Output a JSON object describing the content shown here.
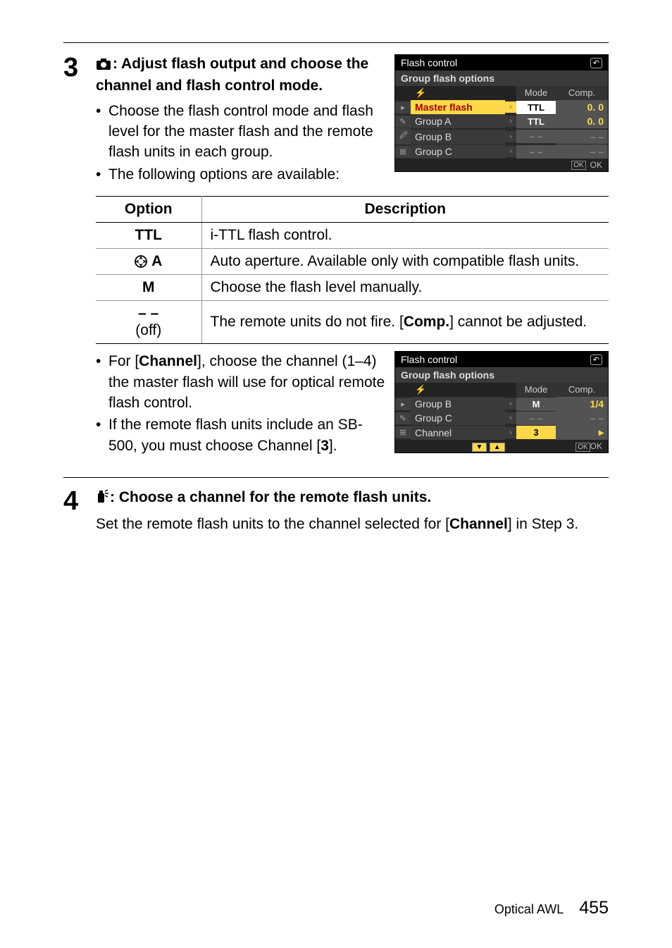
{
  "step3": {
    "number": "3",
    "heading_part1": ": Adjust flash output and choose the channel and flash control mode.",
    "bullet1": "Choose the flash control mode and flash level for the master flash and the remote flash units in each group.",
    "bullet2": "The following options are available:"
  },
  "menu1": {
    "title": "Flash control",
    "subtitle": "Group flash options",
    "col_mode": "Mode",
    "col_comp": "Comp.",
    "rows": [
      {
        "label": "Master flash",
        "mode": "TTL",
        "comp": "0. 0",
        "hl": true
      },
      {
        "label": "Group A",
        "mode": "TTL",
        "comp": "0. 0"
      },
      {
        "label": "Group B",
        "mode": "– –",
        "comp": "– –",
        "blank": true
      },
      {
        "label": "Group C",
        "mode": "– –",
        "comp": "– –",
        "blank": true
      }
    ],
    "ok": "OK"
  },
  "options_table": {
    "header_option": "Option",
    "header_desc": "Description",
    "rows": [
      {
        "opt": "TTL",
        "desc": "i-TTL flash control."
      },
      {
        "opt": "qA",
        "desc": "Auto aperture. Available only with compatible flash units.",
        "icon": true
      },
      {
        "opt": "M",
        "desc": "Choose the flash level manually."
      },
      {
        "opt_dash": "– –",
        "opt_sub": "(off)",
        "desc_pre": "The remote units do not fire. [",
        "desc_bold": "Comp.",
        "desc_post": "] cannot be adjusted."
      }
    ]
  },
  "step3b": {
    "bullet3_pre": "For [",
    "bullet3_bold": "Channel",
    "bullet3_post": "], choose the channel (1–4) the master flash will use for optical remote flash control.",
    "bullet4_pre": "If the remote flash units include an SB-500, you must choose Channel [",
    "bullet4_bold": "3",
    "bullet4_post": "]."
  },
  "menu2": {
    "title": "Flash control",
    "subtitle": "Group flash options",
    "col_mode": "Mode",
    "col_comp": "Comp.",
    "rows": [
      {
        "label": "Group B",
        "mode": "M",
        "comp": "1/4"
      },
      {
        "label": "Group C",
        "mode": "– –",
        "comp": "– –",
        "blank": true
      },
      {
        "label": "Channel",
        "mode": "3",
        "comp": "",
        "sel": true
      }
    ],
    "ok": "OK"
  },
  "step4": {
    "number": "4",
    "heading": ": Choose a channel for the remote flash units.",
    "body_pre": "Set the remote flash units to the channel selected for [",
    "body_bold": "Channel",
    "body_post": "] in Step 3."
  },
  "footer": {
    "section": "Optical AWL",
    "page": "455"
  }
}
